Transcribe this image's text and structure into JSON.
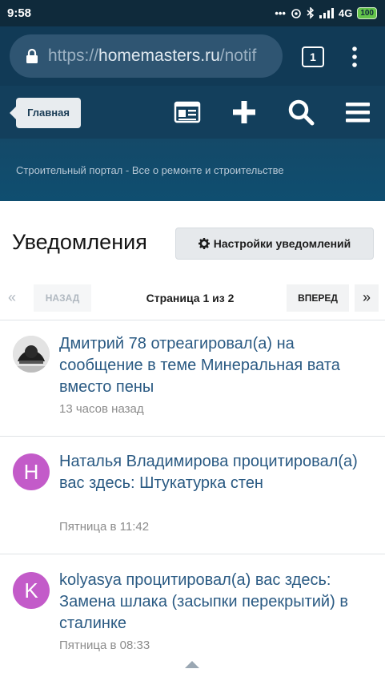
{
  "status_bar": {
    "time": "9:58",
    "signal": "•••",
    "network": "4G",
    "battery": "100"
  },
  "browser": {
    "url_scheme": "https://",
    "url_host": "homemasters.ru",
    "url_path": "/notif",
    "tab_count": "1"
  },
  "site": {
    "home_label": "Главная",
    "tagline": "Строительный портал - Все о ремонте и строительстве"
  },
  "page": {
    "title": "Уведомления",
    "settings_label": "Настройки уведомлений"
  },
  "pager": {
    "first": "«",
    "prev": "НАЗАД",
    "info": "Страница 1 из 2",
    "next": "ВПЕРЕД",
    "last": "»"
  },
  "notifications": [
    {
      "avatar_letter": "",
      "avatar_color": "#d9d9d9",
      "text": "Дмитрий 78 отреагировал(а) на сообщение в теме Минеральная вата вместо пены",
      "time": "13 часов назад"
    },
    {
      "avatar_letter": "Н",
      "avatar_color": "#c35bc9",
      "text": "Наталья Владимирова процитировал(а) вас здесь: Штукатурка стен",
      "time": "Пятница в 11:42"
    },
    {
      "avatar_letter": "K",
      "avatar_color": "#c35bc9",
      "text": "kolyasya процитировал(а) вас здесь: Замена шлака (засыпки перекрытий) в сталинке",
      "time": "Пятница в 08:33"
    }
  ],
  "colors": {
    "header": "#113a56",
    "link": "#2a5a83",
    "avatar_purple": "#c35bc9"
  }
}
